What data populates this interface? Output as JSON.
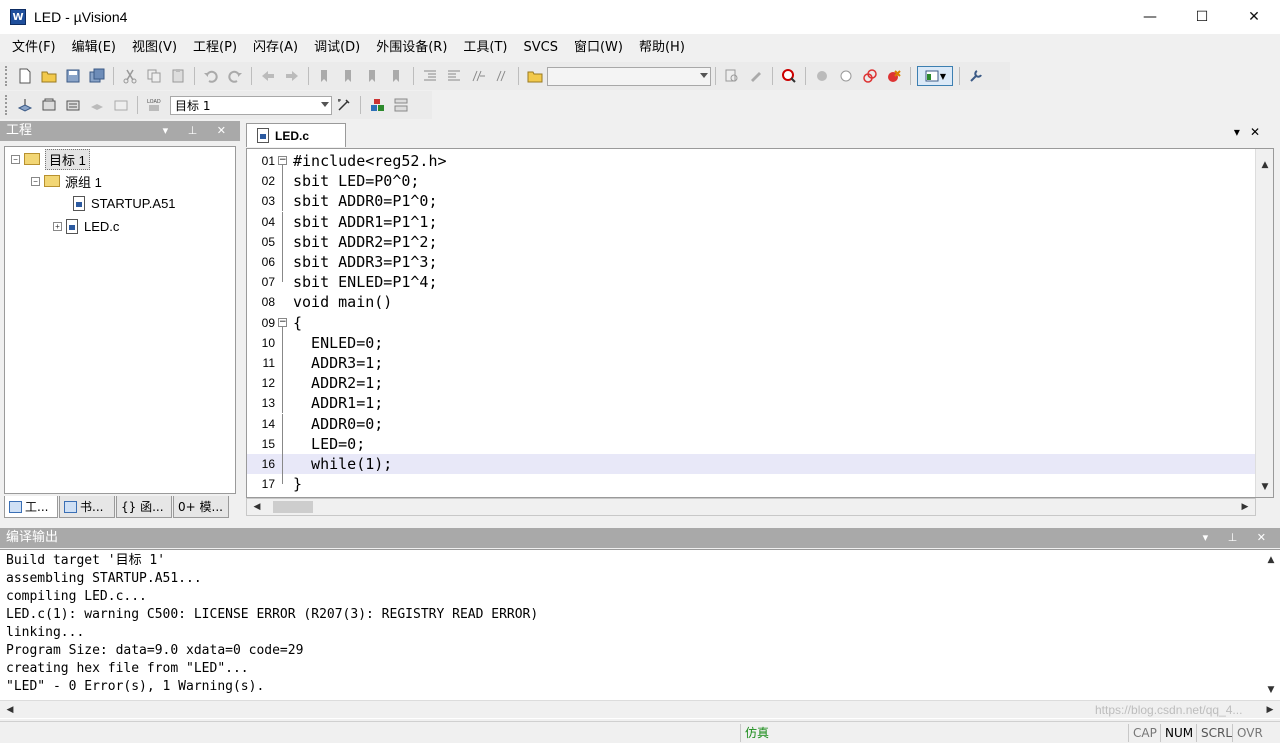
{
  "window": {
    "title": "LED  - µVision4",
    "app_icon_letter": "W",
    "minimize": "—",
    "maximize": "☐",
    "close": "✕"
  },
  "menu": [
    "文件(F)",
    "编辑(E)",
    "视图(V)",
    "工程(P)",
    "闪存(A)",
    "调试(D)",
    "外围设备(R)",
    "工具(T)",
    "SVCS",
    "窗口(W)",
    "帮助(H)"
  ],
  "toolbar2": {
    "target_select": "目标 1"
  },
  "project_panel": {
    "title": "工程",
    "tree": {
      "target": "目标 1",
      "group": "源组 1",
      "files": [
        "STARTUP.A51",
        "LED.c"
      ]
    },
    "tabs": [
      "工...",
      "书...",
      "{} 函...",
      "0+ 模..."
    ]
  },
  "editor": {
    "tab": "LED.c",
    "lines": [
      {
        "n": "01",
        "text": "#include<reg52.h>"
      },
      {
        "n": "02",
        "text": "sbit LED=P0^0;"
      },
      {
        "n": "03",
        "text": "sbit ADDR0=P1^0;"
      },
      {
        "n": "04",
        "text": "sbit ADDR1=P1^1;"
      },
      {
        "n": "05",
        "text": "sbit ADDR2=P1^2;"
      },
      {
        "n": "06",
        "text": "sbit ADDR3=P1^3;"
      },
      {
        "n": "07",
        "text": "sbit ENLED=P1^4;"
      },
      {
        "n": "08",
        "text": "void main()"
      },
      {
        "n": "09",
        "text": "{"
      },
      {
        "n": "10",
        "text": "  ENLED=0;"
      },
      {
        "n": "11",
        "text": "  ADDR3=1;"
      },
      {
        "n": "12",
        "text": "  ADDR2=1;"
      },
      {
        "n": "13",
        "text": "  ADDR1=1;"
      },
      {
        "n": "14",
        "text": "  ADDR0=0;"
      },
      {
        "n": "15",
        "text": "  LED=0;"
      },
      {
        "n": "16",
        "text": "  while(1);"
      },
      {
        "n": "17",
        "text": "}"
      }
    ],
    "current_line": "16"
  },
  "output": {
    "title": "编译输出",
    "lines": [
      "Build target '目标 1'",
      "assembling STARTUP.A51...",
      "compiling LED.c...",
      "LED.c(1): warning C500: LICENSE ERROR (R207(3): REGISTRY READ ERROR)",
      "linking...",
      "Program Size: data=9.0 xdata=0 code=29",
      "creating hex file from \"LED\"...",
      "\"LED\" - 0 Error(s), 1 Warning(s)."
    ]
  },
  "status": {
    "mode": "仿真",
    "cap": "CAP",
    "num": "NUM",
    "scrl": "SCRL",
    "ovr": "OVR",
    "watermark": "https://blog.csdn.net/qq_4..."
  },
  "colors": {
    "panel_title_bg": "#a9a9a9",
    "current_line_bg": "#e8e8f8",
    "simulation_text": "#1a8c1a"
  }
}
